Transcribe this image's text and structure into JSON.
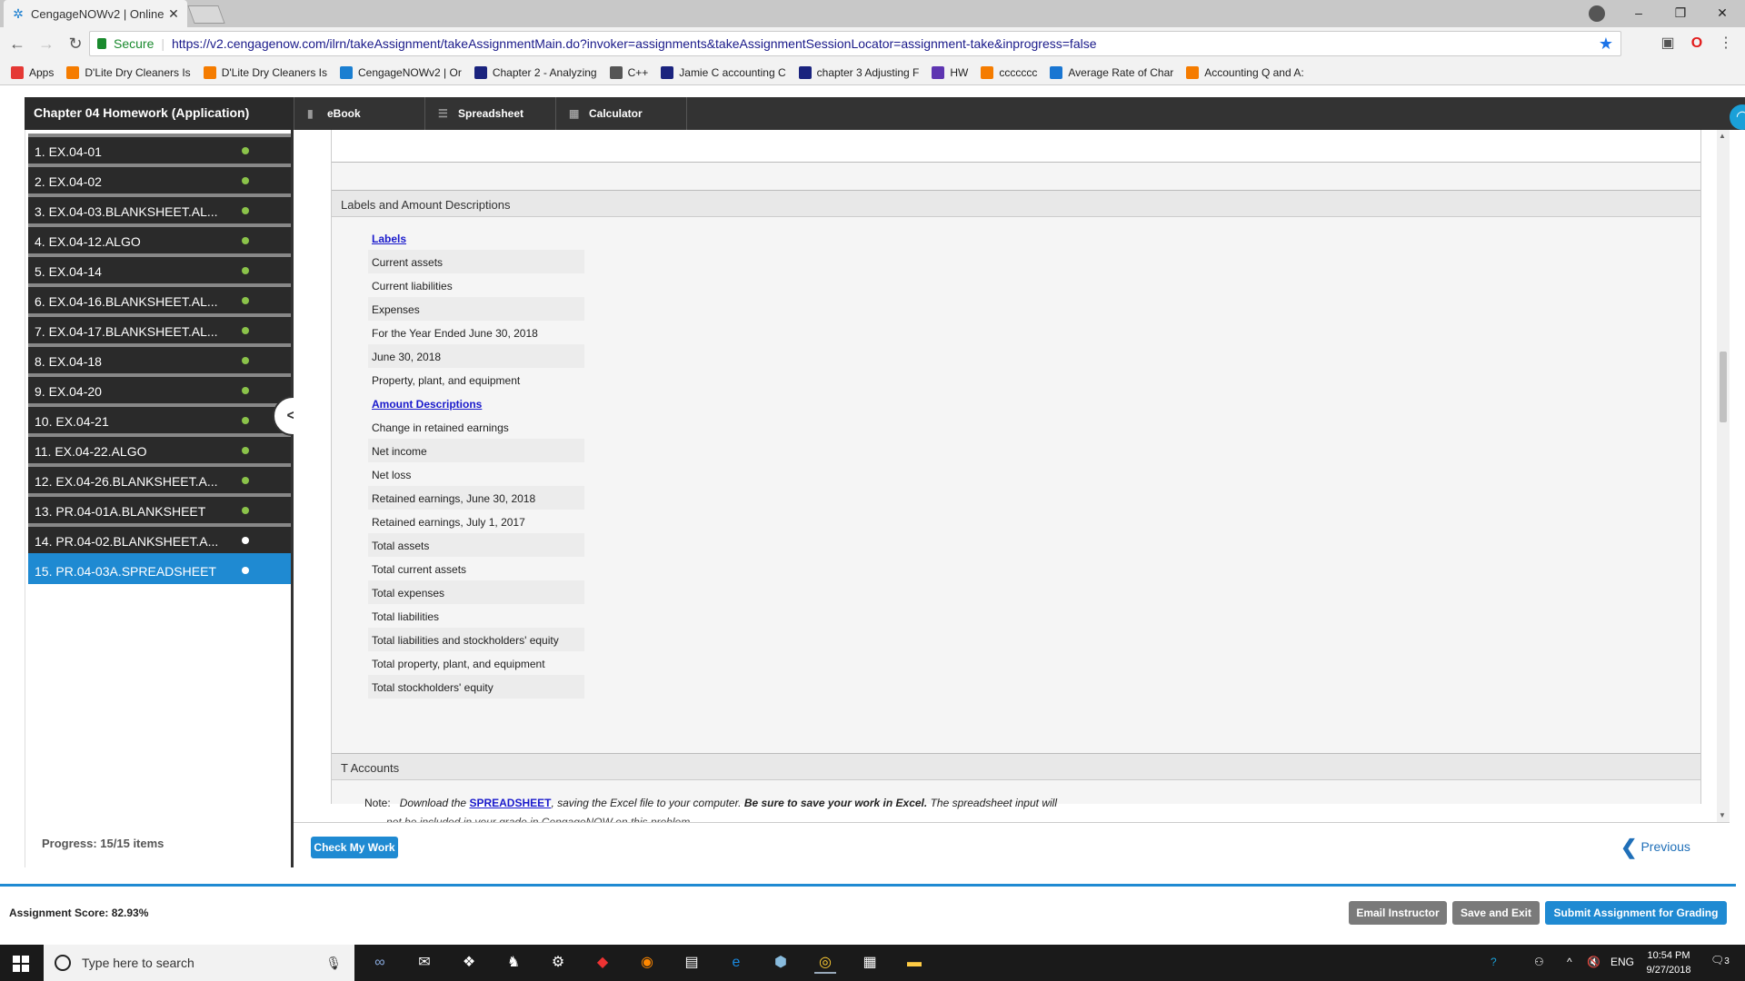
{
  "browser": {
    "tab_title": "CengageNOWv2 | Online",
    "tab_close": "✕",
    "secure_label": "Secure",
    "url": "https://v2.cengagenow.com/ilrn/takeAssignment/takeAssignmentMain.do?invoker=assignments&takeAssignmentSessionLocator=assignment-take&inprogress=false",
    "bookmarks": [
      {
        "label": "Apps",
        "color": "#e53935"
      },
      {
        "label": "D'Lite Dry Cleaners Is",
        "color": "#f57c00"
      },
      {
        "label": "D'Lite Dry Cleaners Is",
        "color": "#f57c00"
      },
      {
        "label": "CengageNOWv2 | Or",
        "color": "#1b7fd1"
      },
      {
        "label": "Chapter 2 - Analyzing",
        "color": "#1a237e"
      },
      {
        "label": "C++",
        "color": "#555555"
      },
      {
        "label": "Jamie C accounting C",
        "color": "#1a237e"
      },
      {
        "label": "chapter 3 Adjusting F",
        "color": "#1a237e"
      },
      {
        "label": "HW",
        "color": "#5e35b1"
      },
      {
        "label": "ccccccc",
        "color": "#f57c00"
      },
      {
        "label": "Average Rate of Char",
        "color": "#1976d2"
      },
      {
        "label": "Accounting Q and A:",
        "color": "#f57c00"
      }
    ]
  },
  "app": {
    "assignment_title": "Chapter 04 Homework (Application)",
    "tools": [
      {
        "label": "eBook",
        "icon": "book-icon"
      },
      {
        "label": "Spreadsheet",
        "icon": "list-icon"
      },
      {
        "label": "Calculator",
        "icon": "calculator-icon"
      }
    ]
  },
  "sidebar": {
    "items": [
      {
        "label": "1. EX.04-01",
        "status": "complete"
      },
      {
        "label": "2. EX.04-02",
        "status": "complete"
      },
      {
        "label": "3. EX.04-03.BLANKSHEET.AL...",
        "status": "complete"
      },
      {
        "label": "4. EX.04-12.ALGO",
        "status": "complete"
      },
      {
        "label": "5. EX.04-14",
        "status": "complete"
      },
      {
        "label": "6. EX.04-16.BLANKSHEET.AL...",
        "status": "complete"
      },
      {
        "label": "7. EX.04-17.BLANKSHEET.AL...",
        "status": "complete"
      },
      {
        "label": "8. EX.04-18",
        "status": "complete"
      },
      {
        "label": "9. EX.04-20",
        "status": "complete"
      },
      {
        "label": "10. EX.04-21",
        "status": "complete"
      },
      {
        "label": "11. EX.04-22.ALGO",
        "status": "complete"
      },
      {
        "label": "12. EX.04-26.BLANKSHEET.A...",
        "status": "complete"
      },
      {
        "label": "13. PR.04-01A.BLANKSHEET",
        "status": "complete"
      },
      {
        "label": "14. PR.04-02.BLANKSHEET.A...",
        "status": "incomplete"
      },
      {
        "label": "15. PR.04-03A.SPREADSHEET",
        "status": "current"
      }
    ],
    "progress": "Progress:  15/15 items",
    "collapse_glyph": "<"
  },
  "content": {
    "labels_section_title": "Labels and Amount Descriptions",
    "labels_heading": "Labels",
    "labels": [
      "Current assets",
      "Current liabilities",
      "Expenses",
      "For the Year Ended June 30, 2018",
      "June 30, 2018",
      "Property, plant, and equipment"
    ],
    "amounts_heading": "Amount Descriptions",
    "amounts": [
      "Change in retained earnings",
      "Net income",
      "Net loss",
      "Retained earnings, June 30, 2018",
      "Retained earnings, July 1, 2017",
      "Total assets",
      "Total current assets",
      "Total expenses",
      "Total liabilities",
      "Total liabilities and stockholders' equity",
      "Total property, plant, and equipment",
      "Total stockholders' equity"
    ],
    "t_accounts_title": "T Accounts",
    "note_lead": "Note:",
    "note_part1": "Download the",
    "note_link": "SPREADSHEET",
    "note_part2": ", saving the Excel file to your computer.",
    "note_bold": "Be sure to save your work in Excel.",
    "note_part3": "The spreadsheet input will",
    "note_line2": "not be included in your grade in CengageNOW on this problem."
  },
  "footer": {
    "check_label": "Check My Work",
    "previous_label": "Previous",
    "score_label": "Assignment Score: 82.93%",
    "email_label": "Email Instructor",
    "save_label": "Save and Exit",
    "submit_label": "Submit Assignment for Grading"
  },
  "taskbar": {
    "search_placeholder": "Type here to search",
    "language": "ENG",
    "time": "10:54 PM",
    "date": "9/27/2018",
    "notifications": "3"
  },
  "colors": {
    "accent": "#1f8ad2",
    "complete_dot": "#8bc34a",
    "dark_bar": "#2a2a2a",
    "button_gray": "#777777"
  }
}
